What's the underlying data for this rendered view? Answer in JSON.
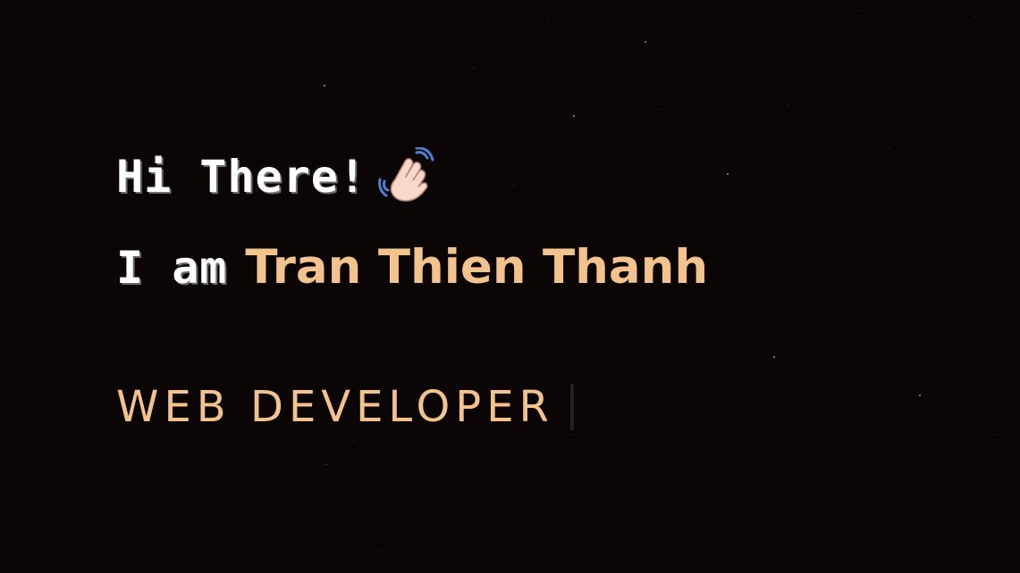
{
  "hero": {
    "greeting": "Hi There!",
    "wave_emoji": "waving-hand-icon",
    "intro_prefix": "I am",
    "name": "Tran Thien Thanh",
    "role": "WEB DEVELOPER"
  },
  "colors": {
    "background": "#0c0505",
    "accent": "#f2c38d",
    "text": "#ffffff"
  }
}
